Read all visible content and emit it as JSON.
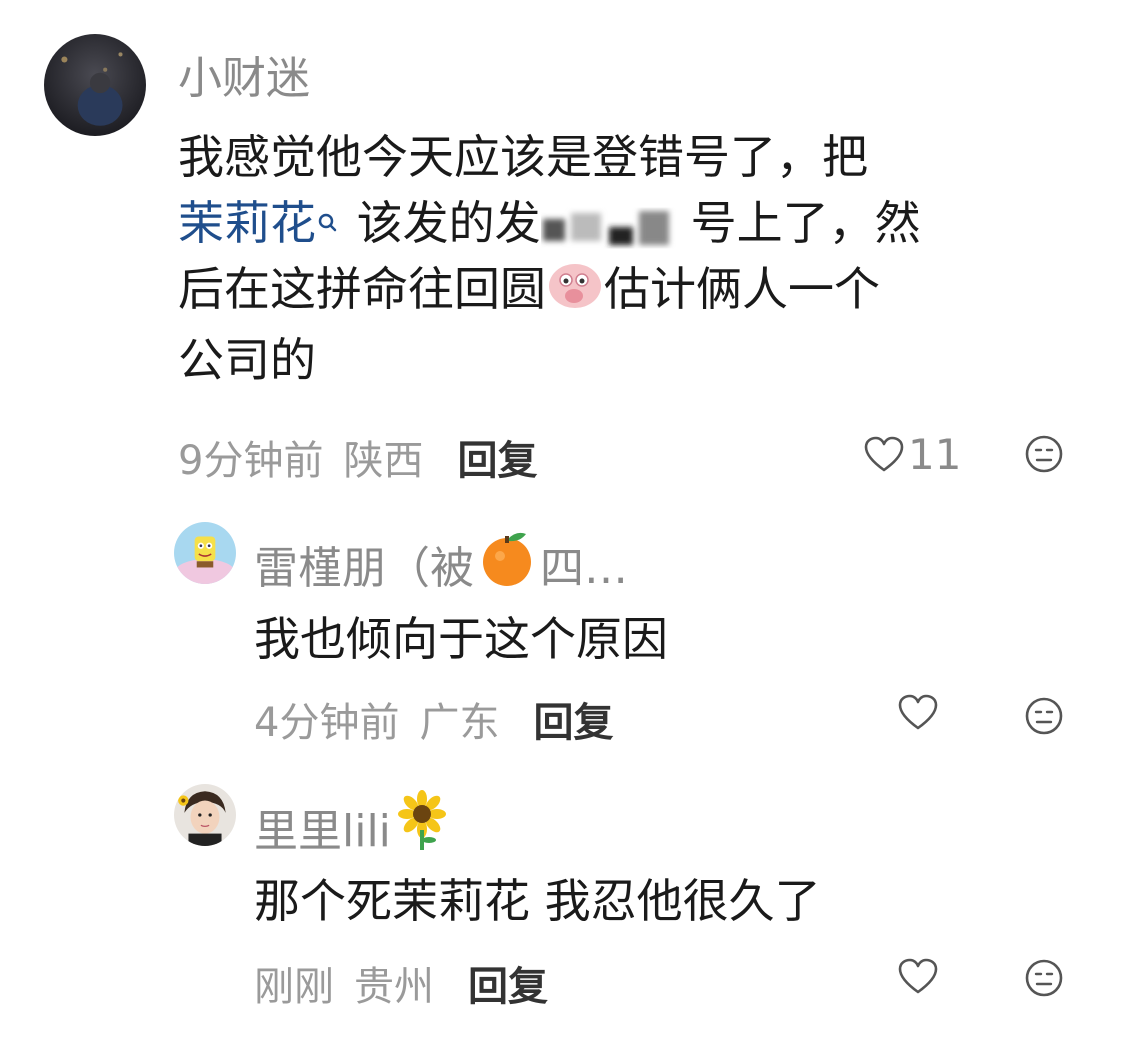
{
  "comments": [
    {
      "username": "小财迷",
      "text_line1": "我感觉他今天应该是登错号了，把",
      "topic": "茉莉花",
      "text_line2_after_topic": "该发的发",
      "text_line2_end": "号上了，然",
      "text_line3_start": "后在这拼命往回圆",
      "text_line3_end": "估计俩人一个",
      "text_line4": "公司的",
      "time": "9分钟前",
      "location": "陕西",
      "reply_label": "回复",
      "likes": "11"
    },
    {
      "username": "雷槿朋（被",
      "username_tail": "四…",
      "text": "我也倾向于这个原因",
      "time": "4分钟前",
      "location": "广东",
      "reply_label": "回复"
    },
    {
      "username": "里里lili",
      "text": "那个死茉莉花 我忍他很久了",
      "time": "刚刚",
      "location": "贵州",
      "reply_label": "回复"
    }
  ],
  "colors": {
    "username": "#8a8a8a",
    "text": "#1a1a1a",
    "meta": "#9a9a9a",
    "topic": "#1f4e8c",
    "reply": "#333333"
  },
  "icons": [
    "heart-outline-icon",
    "neutral-face-icon",
    "search-icon",
    "orange-emoji",
    "sunflower-emoji",
    "covering-mouth-emoji"
  ]
}
